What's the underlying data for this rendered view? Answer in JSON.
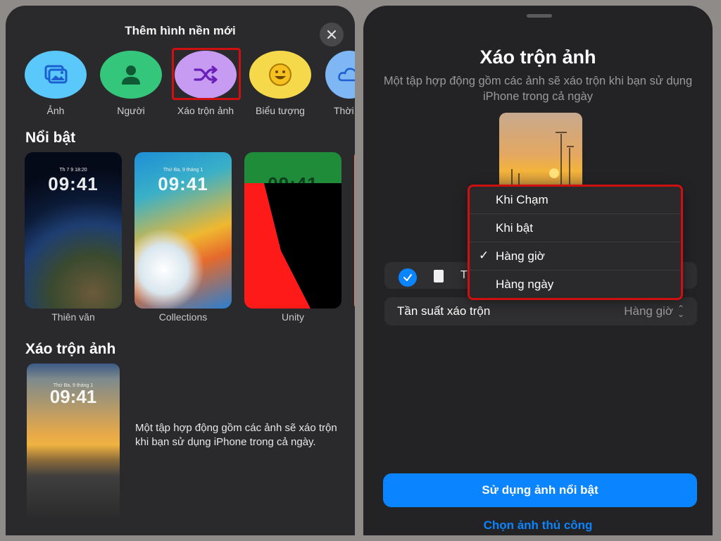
{
  "left": {
    "title": "Thêm hình nền mới",
    "categories": [
      {
        "label": "Ảnh",
        "icon": "photos-icon",
        "color": "#5ac8fa"
      },
      {
        "label": "Người",
        "icon": "person-icon",
        "color": "#34c77b"
      },
      {
        "label": "Xáo trộn ảnh",
        "icon": "shuffle-icon",
        "color": "#c79bf2"
      },
      {
        "label": "Biểu tượng",
        "icon": "emoji-icon",
        "color": "#f5d94a"
      },
      {
        "label": "Thời",
        "icon": "weather-icon",
        "color": "#7fb7f5"
      }
    ],
    "featured_title": "Nổi bật",
    "featured": [
      {
        "caption": "Thiên văn",
        "time": "09:41",
        "small": "Th 7 9 18:20"
      },
      {
        "caption": "Collections",
        "time": "09:41",
        "small": "Thứ Ba, 9 tháng 1"
      },
      {
        "caption": "Unity",
        "time": "09:41",
        "small": ""
      }
    ],
    "shuffle_title": "Xáo trộn ảnh",
    "shuffle_time": "09:41",
    "shuffle_small": "Thứ Ba, 9 tháng 1",
    "shuffle_desc": "Một tập hợp động gồm các ảnh sẽ xáo trộn khi bạn sử dụng iPhone trong cả ngày."
  },
  "right": {
    "title": "Xáo trộn ảnh",
    "desc": "Một tập hợp động gồm các ảnh sẽ xáo trộn khi bạn sử dụng iPhone trong cả ngày",
    "row1_text": "T",
    "freq_label": "Tần suất xáo trộn",
    "freq_value": "Hàng giờ",
    "dropdown": [
      {
        "label": "Khi Chạm",
        "checked": false
      },
      {
        "label": "Khi bật",
        "checked": false
      },
      {
        "label": "Hàng giờ",
        "checked": true
      },
      {
        "label": "Hàng ngày",
        "checked": false
      }
    ],
    "primary_button": "Sử dụng ảnh nổi bật",
    "link_button": "Chọn ảnh thủ công"
  },
  "colors": {
    "accent": "#0a84ff",
    "highlight": "#d01010"
  }
}
